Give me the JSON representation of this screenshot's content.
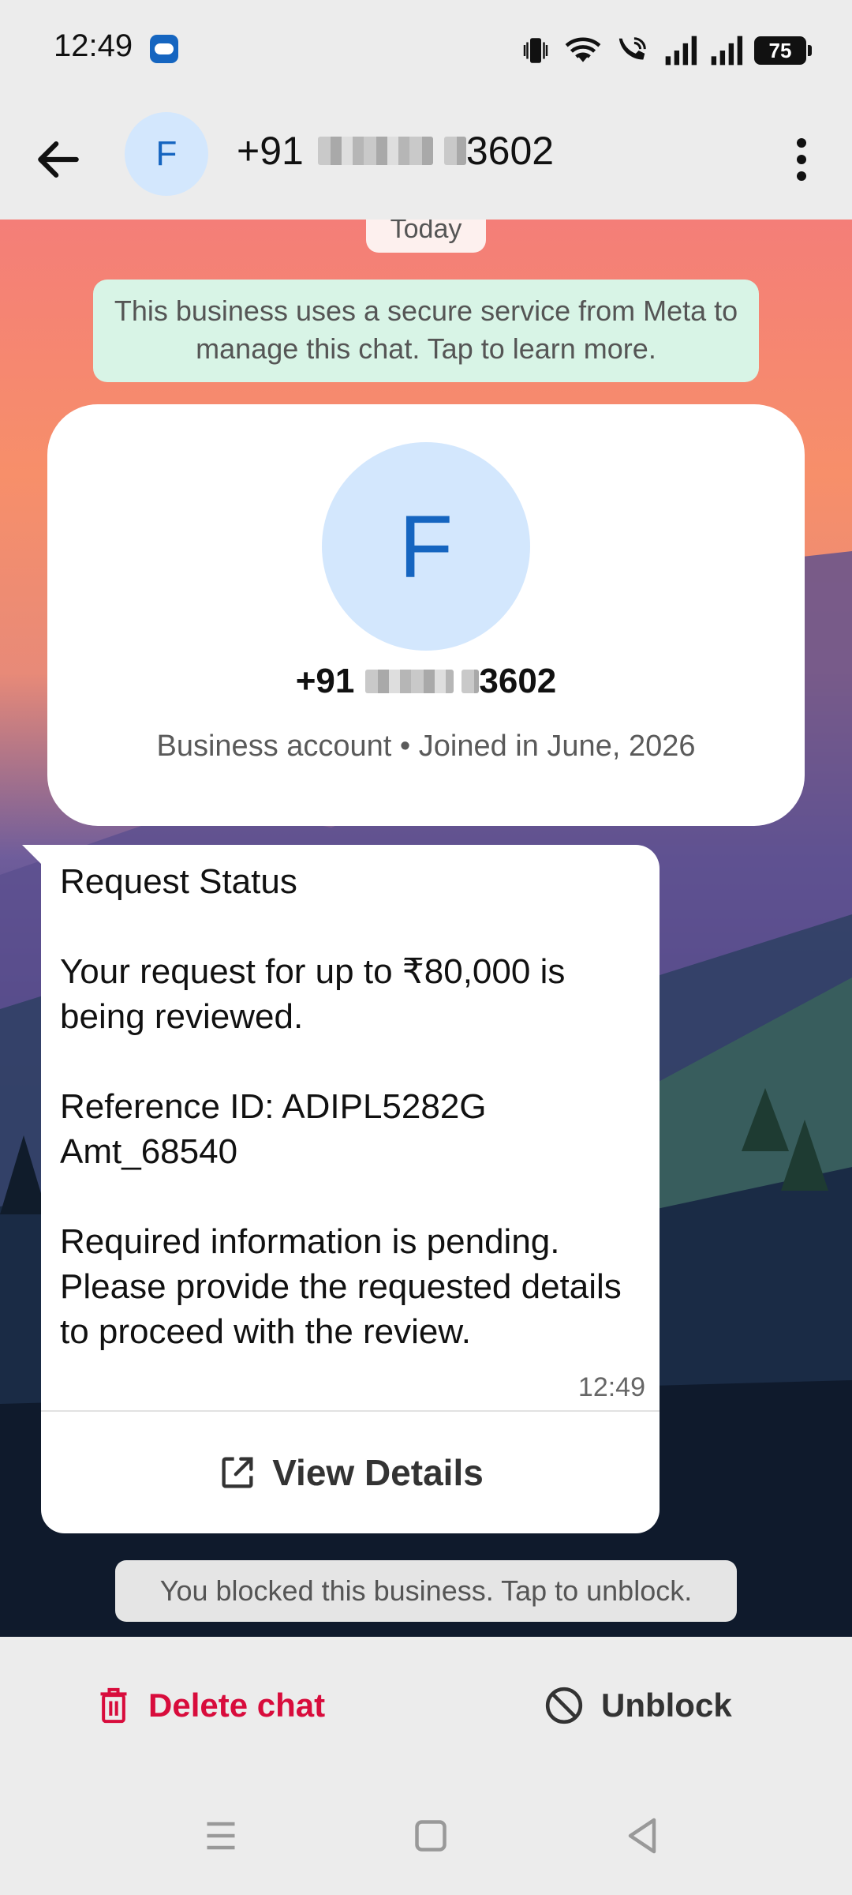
{
  "status_bar": {
    "time": "12:49",
    "battery": "75"
  },
  "header": {
    "avatar_letter": "F",
    "phone_prefix": "+91",
    "phone_suffix": "3602"
  },
  "chat": {
    "date_label": "Today",
    "meta_notice": "This business uses a secure service from Meta to manage this chat. Tap to learn more.",
    "profile": {
      "avatar_letter": "F",
      "phone_prefix": "+91",
      "phone_suffix": "3602",
      "subtitle": "Business account • Joined in June, 2026"
    },
    "message": {
      "title": "Request Status",
      "line1": "Your request for up to ₹80,000 is being reviewed.",
      "line2": "Reference ID: ADIPL5282G Amt_68540",
      "line3": "Required information is pending. Please provide the requested details to proceed with the review.",
      "time": "12:49",
      "button_label": "View Details"
    },
    "blocked_notice": "You blocked this business. Tap to unblock."
  },
  "actions": {
    "delete_label": "Delete chat",
    "unblock_label": "Unblock"
  },
  "colors": {
    "danger": "#d80c3c",
    "avatar_bg": "#d3e7fd",
    "avatar_fg": "#1565c0",
    "meta_bg": "#d8f4e6"
  }
}
